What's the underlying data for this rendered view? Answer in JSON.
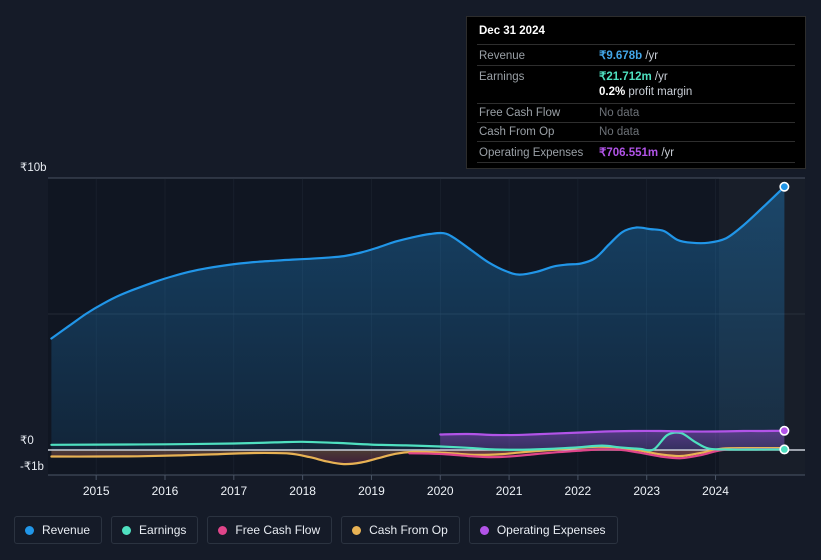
{
  "chart_data": {
    "type": "line",
    "title": "",
    "xlabel": "",
    "ylabel": "",
    "currency_symbol": "₹",
    "y_ticks": [
      {
        "label": "₹10b",
        "value": 10000000000
      },
      {
        "label": "₹0",
        "value": 0
      },
      {
        "label": "-₹1b",
        "value": -1000000000
      }
    ],
    "ylim": [
      -1600000000,
      10600000000
    ],
    "grid": true,
    "legend_position": "bottom",
    "x": [
      "2015",
      "2016",
      "2017",
      "2018",
      "2019",
      "2020",
      "2021",
      "2022",
      "2023",
      "2024"
    ],
    "xlim": [
      2014.3,
      2025.3
    ],
    "series": [
      {
        "name": "Revenue",
        "color": "#2196e8",
        "points": [
          [
            2014.35,
            4.1
          ],
          [
            2014.6,
            4.55
          ],
          [
            2014.85,
            5.0
          ],
          [
            2015.1,
            5.38
          ],
          [
            2015.35,
            5.7
          ],
          [
            2015.6,
            5.95
          ],
          [
            2015.85,
            6.18
          ],
          [
            2016.1,
            6.38
          ],
          [
            2016.35,
            6.55
          ],
          [
            2016.6,
            6.68
          ],
          [
            2016.85,
            6.78
          ],
          [
            2017.1,
            6.86
          ],
          [
            2017.35,
            6.92
          ],
          [
            2017.6,
            6.96
          ],
          [
            2017.85,
            7.0
          ],
          [
            2018.1,
            7.03
          ],
          [
            2018.35,
            7.07
          ],
          [
            2018.6,
            7.13
          ],
          [
            2018.85,
            7.26
          ],
          [
            2019.1,
            7.45
          ],
          [
            2019.35,
            7.66
          ],
          [
            2019.6,
            7.82
          ],
          [
            2019.85,
            7.94
          ],
          [
            2020.05,
            7.97
          ],
          [
            2020.2,
            7.8
          ],
          [
            2020.45,
            7.35
          ],
          [
            2020.7,
            6.9
          ],
          [
            2020.95,
            6.58
          ],
          [
            2021.15,
            6.45
          ],
          [
            2021.4,
            6.55
          ],
          [
            2021.65,
            6.75
          ],
          [
            2021.85,
            6.82
          ],
          [
            2022.05,
            6.86
          ],
          [
            2022.25,
            7.05
          ],
          [
            2022.45,
            7.55
          ],
          [
            2022.65,
            8.02
          ],
          [
            2022.85,
            8.18
          ],
          [
            2023.05,
            8.12
          ],
          [
            2023.25,
            8.05
          ],
          [
            2023.45,
            7.72
          ],
          [
            2023.65,
            7.62
          ],
          [
            2023.9,
            7.62
          ],
          [
            2024.15,
            7.78
          ],
          [
            2024.4,
            8.25
          ],
          [
            2024.7,
            8.95
          ],
          [
            2025.0,
            9.678
          ]
        ],
        "end_value": 9.678,
        "fill": true
      },
      {
        "name": "Earnings",
        "color": "#4fe0c0",
        "points": [
          [
            2014.35,
            0.19
          ],
          [
            2015.0,
            0.2
          ],
          [
            2016.0,
            0.21
          ],
          [
            2017.0,
            0.24
          ],
          [
            2017.6,
            0.28
          ],
          [
            2018.0,
            0.3
          ],
          [
            2018.5,
            0.26
          ],
          [
            2019.0,
            0.2
          ],
          [
            2019.5,
            0.17
          ],
          [
            2020.0,
            0.13
          ],
          [
            2020.4,
            0.08
          ],
          [
            2020.8,
            0.02
          ],
          [
            2021.2,
            0.01
          ],
          [
            2021.6,
            0.04
          ],
          [
            2022.0,
            0.1
          ],
          [
            2022.35,
            0.16
          ],
          [
            2022.6,
            0.1
          ],
          [
            2022.9,
            0.04
          ],
          [
            2023.1,
            0.02
          ],
          [
            2023.3,
            0.55
          ],
          [
            2023.5,
            0.62
          ],
          [
            2023.7,
            0.3
          ],
          [
            2023.9,
            0.05
          ],
          [
            2024.2,
            0.02
          ],
          [
            2024.6,
            0.02
          ],
          [
            2025.0,
            0.0217
          ]
        ],
        "end_value": 0.0217,
        "fill": false
      },
      {
        "name": "Free Cash Flow",
        "color": "#e0458a",
        "points": [
          [
            2019.55,
            -0.12
          ],
          [
            2019.8,
            -0.13
          ],
          [
            2020.1,
            -0.16
          ],
          [
            2020.4,
            -0.22
          ],
          [
            2020.7,
            -0.26
          ],
          [
            2021.0,
            -0.24
          ],
          [
            2021.35,
            -0.16
          ],
          [
            2021.7,
            -0.08
          ],
          [
            2022.0,
            -0.03
          ],
          [
            2022.3,
            0.02
          ],
          [
            2022.6,
            0.01
          ],
          [
            2022.9,
            -0.1
          ],
          [
            2023.2,
            -0.24
          ],
          [
            2023.5,
            -0.3
          ],
          [
            2023.8,
            -0.18
          ],
          [
            2024.1,
            0.0
          ],
          [
            2024.5,
            0.03
          ],
          [
            2025.0,
            0.03
          ]
        ],
        "end_value": 0.03,
        "fill": false
      },
      {
        "name": "Cash From Op",
        "color": "#e8b254",
        "points": [
          [
            2014.35,
            -0.24
          ],
          [
            2015.0,
            -0.24
          ],
          [
            2015.6,
            -0.23
          ],
          [
            2016.2,
            -0.2
          ],
          [
            2016.8,
            -0.15
          ],
          [
            2017.3,
            -0.11
          ],
          [
            2017.8,
            -0.13
          ],
          [
            2018.1,
            -0.26
          ],
          [
            2018.35,
            -0.42
          ],
          [
            2018.6,
            -0.52
          ],
          [
            2018.85,
            -0.46
          ],
          [
            2019.1,
            -0.3
          ],
          [
            2019.35,
            -0.14
          ],
          [
            2019.6,
            -0.07
          ],
          [
            2019.9,
            -0.08
          ],
          [
            2020.2,
            -0.13
          ],
          [
            2020.55,
            -0.18
          ],
          [
            2020.9,
            -0.15
          ],
          [
            2021.3,
            -0.06
          ],
          [
            2021.7,
            0.02
          ],
          [
            2022.0,
            0.08
          ],
          [
            2022.3,
            0.12
          ],
          [
            2022.6,
            0.09
          ],
          [
            2022.9,
            -0.02
          ],
          [
            2023.2,
            -0.16
          ],
          [
            2023.5,
            -0.22
          ],
          [
            2023.8,
            -0.1
          ],
          [
            2024.1,
            0.05
          ],
          [
            2024.5,
            0.07
          ],
          [
            2025.0,
            0.07
          ]
        ],
        "end_value": 0.07,
        "fill": false
      },
      {
        "name": "Operating Expenses",
        "color": "#b254e8",
        "points": [
          [
            2020.0,
            0.57
          ],
          [
            2020.4,
            0.59
          ],
          [
            2020.8,
            0.55
          ],
          [
            2021.2,
            0.56
          ],
          [
            2021.6,
            0.6
          ],
          [
            2022.0,
            0.64
          ],
          [
            2022.4,
            0.68
          ],
          [
            2022.8,
            0.7
          ],
          [
            2023.2,
            0.7
          ],
          [
            2023.6,
            0.68
          ],
          [
            2024.0,
            0.68
          ],
          [
            2024.4,
            0.7
          ],
          [
            2024.7,
            0.7
          ],
          [
            2025.0,
            0.7066
          ]
        ],
        "end_value": 0.7066,
        "fill": true
      }
    ],
    "highlight_band": {
      "from": 2024.05,
      "to": 2025.3
    }
  },
  "tooltip": {
    "date": "Dec 31 2024",
    "rows": [
      {
        "key": "Revenue",
        "value": "₹9.678b",
        "unit": "/yr",
        "color": "#43a6e8",
        "nodata": false
      },
      {
        "key": "Earnings",
        "value": "₹21.712m",
        "unit": "/yr",
        "color": "#4fe0c0",
        "nodata": false
      }
    ],
    "margin_row": {
      "value": "0.2%",
      "label": "profit margin"
    },
    "nodata_rows": [
      {
        "key": "Free Cash Flow",
        "value": "No data"
      },
      {
        "key": "Cash From Op",
        "value": "No data"
      }
    ],
    "opex_row": {
      "key": "Operating Expenses",
      "value": "₹706.551m",
      "unit": "/yr",
      "color": "#b254e8"
    }
  },
  "legend": {
    "items": [
      {
        "label": "Revenue",
        "color": "#2196e8"
      },
      {
        "label": "Earnings",
        "color": "#4fe0c0"
      },
      {
        "label": "Free Cash Flow",
        "color": "#e0458a"
      },
      {
        "label": "Cash From Op",
        "color": "#e8b254"
      },
      {
        "label": "Operating Expenses",
        "color": "#b254e8"
      }
    ]
  }
}
